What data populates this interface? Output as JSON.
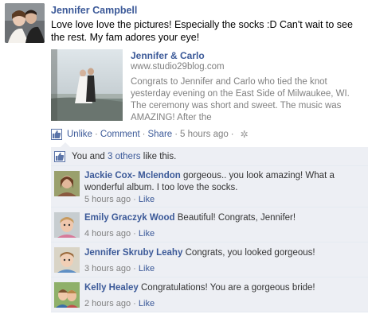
{
  "post": {
    "author": "Jennifer Campbell",
    "message": "Love love love the pictures! Especially the socks :D Can't wait to see the rest. My fam adores your eye!",
    "shared_link": {
      "title": "Jennifer & Carlo",
      "url": "www.studio29blog.com",
      "description": "Congrats to Jennifer and Carlo who tied the knot yesterday evening on the East Side of Milwaukee, WI. The ceremony was short and sweet. The music was AMAZING! After the"
    },
    "actions": {
      "unlike": "Unlike",
      "comment": "Comment",
      "share": "Share",
      "separator": "·",
      "time": "5 hours ago"
    }
  },
  "likes": {
    "prefix": "You and ",
    "others_link": "3 others",
    "suffix": " like this."
  },
  "comments": [
    {
      "author": "Jackie Cox- Mclendon",
      "text": "gorgeous.. you look amazing! What a wonderful album. I too love the socks.",
      "time": "5 hours ago",
      "like": "Like"
    },
    {
      "author": "Emily Graczyk Wood",
      "text": "Beautiful! Congrats, Jennifer!",
      "time": "4 hours ago",
      "like": "Like"
    },
    {
      "author": "Jennifer Skruby Leahy",
      "text": "Congrats, you looked gorgeous!",
      "time": "3 hours ago",
      "like": "Like"
    },
    {
      "author": "Kelly Healey",
      "text": "Congratulations! You are a gorgeous bride!",
      "time": "2 hours ago",
      "like": "Like"
    }
  ],
  "colors": {
    "link": "#3b5998",
    "muted": "#808080",
    "feedback_bg": "#edeff4"
  }
}
